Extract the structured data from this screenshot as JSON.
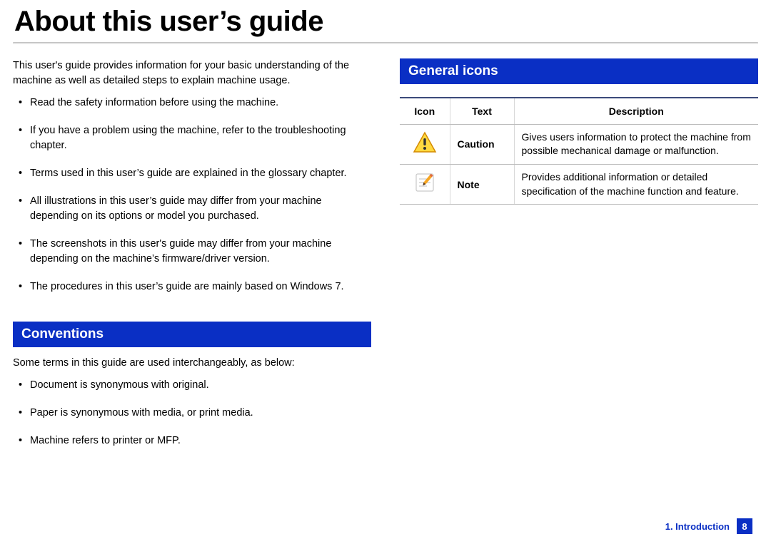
{
  "title": "About this user’s guide",
  "left": {
    "intro": "This user's guide provides information for your basic understanding of the machine as well as detailed steps to explain machine usage.",
    "bullets": [
      "Read the safety information before using the machine.",
      "If you have a problem using the machine, refer to the troubleshooting chapter.",
      "Terms used in this user’s guide are explained in the glossary chapter.",
      "All illustrations in this user’s guide may differ from your machine depending on its options or model you purchased.",
      "The screenshots in this user's guide may differ from your machine depending on the machine’s firmware/driver version.",
      "The procedures in this user’s guide are mainly based on Windows 7."
    ],
    "conventions_heading": "Conventions",
    "conventions_intro": "Some terms in this guide are used interchangeably, as below:",
    "conventions_bullets": [
      "Document is synonymous with original.",
      "Paper is synonymous with media, or print media.",
      "Machine refers to printer or MFP."
    ]
  },
  "right": {
    "heading": "General icons",
    "table": {
      "headers": {
        "icon": "Icon",
        "text": "Text",
        "desc": "Description"
      },
      "rows": [
        {
          "icon": "caution-icon",
          "text": "Caution",
          "desc": "Gives users information to protect the machine from possible mechanical damage or malfunction."
        },
        {
          "icon": "note-icon",
          "text": "Note",
          "desc": "Provides additional information or detailed specification of the machine function and feature."
        }
      ]
    }
  },
  "footer": {
    "chapter": "1. Introduction",
    "page": "8"
  }
}
